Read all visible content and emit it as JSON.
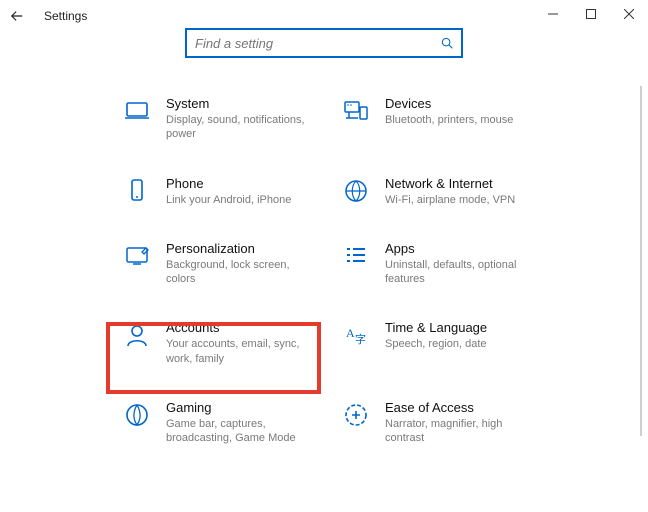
{
  "window": {
    "title": "Settings"
  },
  "search": {
    "placeholder": "Find a setting"
  },
  "tiles": {
    "system": {
      "title": "System",
      "sub": "Display, sound, notifications, power"
    },
    "devices": {
      "title": "Devices",
      "sub": "Bluetooth, printers, mouse"
    },
    "phone": {
      "title": "Phone",
      "sub": "Link your Android, iPhone"
    },
    "network": {
      "title": "Network & Internet",
      "sub": "Wi-Fi, airplane mode, VPN"
    },
    "personal": {
      "title": "Personalization",
      "sub": "Background, lock screen, colors"
    },
    "apps": {
      "title": "Apps",
      "sub": "Uninstall, defaults, optional features"
    },
    "accounts": {
      "title": "Accounts",
      "sub": "Your accounts, email, sync, work, family"
    },
    "time": {
      "title": "Time & Language",
      "sub": "Speech, region, date"
    },
    "gaming": {
      "title": "Gaming",
      "sub": "Game bar, captures, broadcasting, Game Mode"
    },
    "ease": {
      "title": "Ease of Access",
      "sub": "Narrator, magnifier, high contrast"
    }
  }
}
